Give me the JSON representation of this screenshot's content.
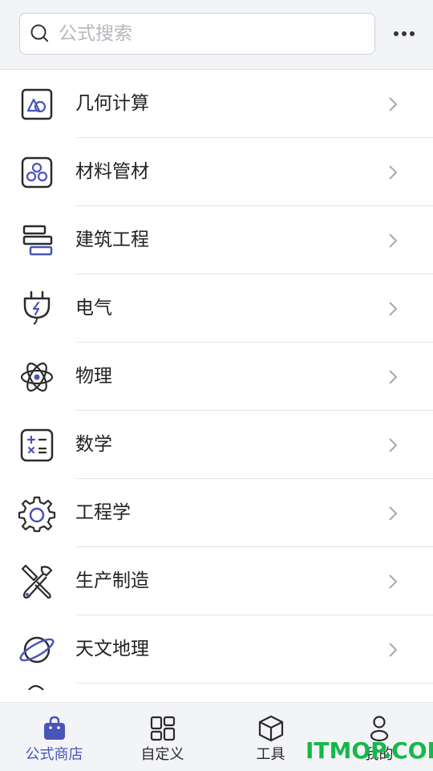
{
  "search": {
    "placeholder": "公式搜索"
  },
  "header": {
    "more_icon": "more-dots-icon"
  },
  "categories": [
    {
      "label": "几何计算",
      "icon": "geometry-shapes-icon"
    },
    {
      "label": "材料管材",
      "icon": "materials-pipes-icon"
    },
    {
      "label": "建筑工程",
      "icon": "construction-blocks-icon"
    },
    {
      "label": "电气",
      "icon": "electric-plug-icon"
    },
    {
      "label": "物理",
      "icon": "atom-icon"
    },
    {
      "label": "数学",
      "icon": "calculator-icon"
    },
    {
      "label": "工程学",
      "icon": "gear-icon"
    },
    {
      "label": "生产制造",
      "icon": "tools-icon"
    },
    {
      "label": "天文地理",
      "icon": "planet-icon"
    }
  ],
  "tabs": [
    {
      "label": "公式商店",
      "icon": "shopping-bag-icon",
      "active": true
    },
    {
      "label": "自定义",
      "icon": "grid-icon",
      "active": false
    },
    {
      "label": "工具",
      "icon": "cube-icon",
      "active": false
    },
    {
      "label": "我的",
      "icon": "person-icon",
      "active": false
    }
  ],
  "watermark": {
    "text": "ITMOP.COM"
  },
  "colors": {
    "accent": "#4a55b8",
    "icon_stroke": "#2b2b2b",
    "watermark": "#16b84a"
  }
}
